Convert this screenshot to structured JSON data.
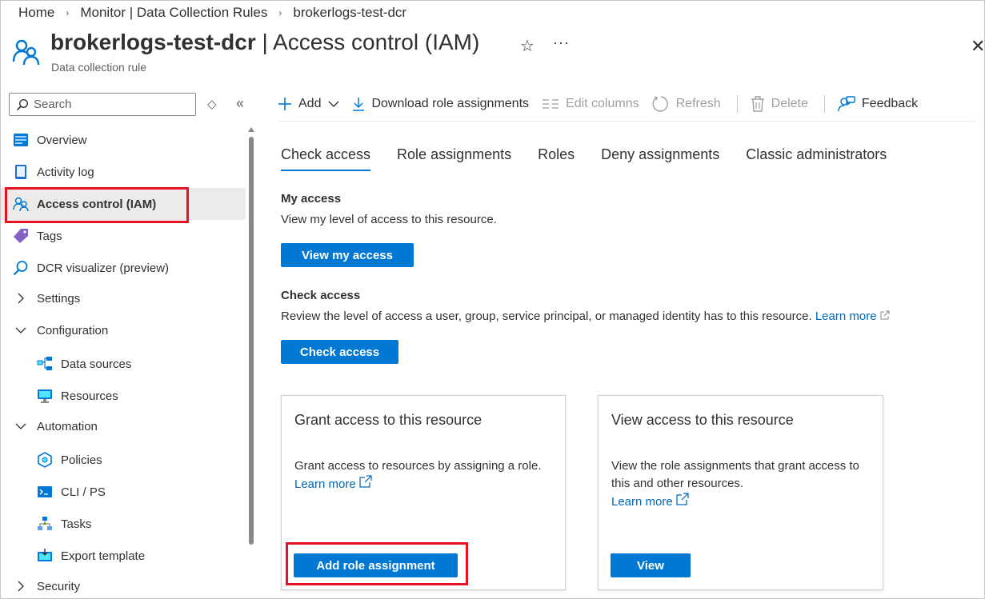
{
  "breadcrumb": {
    "items": [
      "Home",
      "Monitor | Data Collection Rules",
      "brokerlogs-test-dcr"
    ],
    "separator": "›"
  },
  "header": {
    "resource_name": "brokerlogs-test-dcr",
    "title_separator": " | ",
    "page_name": "Access control (IAM)",
    "subtitle": "Data collection rule",
    "star_glyph": "☆",
    "more_glyph": "···",
    "close_glyph": "✕"
  },
  "sidebar": {
    "search_placeholder": "Search",
    "sort_glyph": "◇",
    "collapse_glyph": "«",
    "items": [
      {
        "label": "Overview",
        "icon": "overview-icon"
      },
      {
        "label": "Activity log",
        "icon": "activity-log-icon"
      },
      {
        "label": "Access control (IAM)",
        "icon": "iam-icon",
        "active": true
      },
      {
        "label": "Tags",
        "icon": "tag-icon"
      },
      {
        "label": "DCR visualizer (preview)",
        "icon": "visualizer-icon"
      },
      {
        "label": "Settings",
        "icon": "chevron-right-icon"
      },
      {
        "label": "Configuration",
        "icon": "chevron-down-icon"
      },
      {
        "label": "Data sources",
        "icon": "data-sources-icon"
      },
      {
        "label": "Resources",
        "icon": "resources-icon"
      },
      {
        "label": "Automation",
        "icon": "chevron-down-icon"
      },
      {
        "label": "Policies",
        "icon": "policies-icon"
      },
      {
        "label": "CLI / PS",
        "icon": "cli-icon"
      },
      {
        "label": "Tasks",
        "icon": "tasks-icon"
      },
      {
        "label": "Export template",
        "icon": "export-template-icon"
      },
      {
        "label": "Security",
        "icon": "chevron-right-icon"
      }
    ]
  },
  "toolbar": {
    "add": "Add",
    "download": "Download role assignments",
    "edit_columns": "Edit columns",
    "refresh": "Refresh",
    "delete": "Delete",
    "feedback": "Feedback"
  },
  "tabs": [
    "Check access",
    "Role assignments",
    "Roles",
    "Deny assignments",
    "Classic administrators"
  ],
  "my_access": {
    "title": "My access",
    "description": "View my level of access to this resource.",
    "button": "View my access"
  },
  "check_access": {
    "title": "Check access",
    "description": "Review the level of access a user, group, service principal, or managed identity has to this resource.",
    "learn_more": "Learn more",
    "button": "Check access"
  },
  "grant_card": {
    "title": "Grant access to this resource",
    "description": "Grant access to resources by assigning a role.",
    "learn_more": "Learn more",
    "button": "Add role assignment"
  },
  "view_card": {
    "title": "View access to this resource",
    "description": "View the role assignments that grant access to this and other resources.",
    "learn_more": "Learn more",
    "button": "View"
  },
  "colors": {
    "accent": "#0078d4",
    "link": "#0067b8",
    "highlight": "#e81123",
    "active_bg": "#edebe9"
  }
}
